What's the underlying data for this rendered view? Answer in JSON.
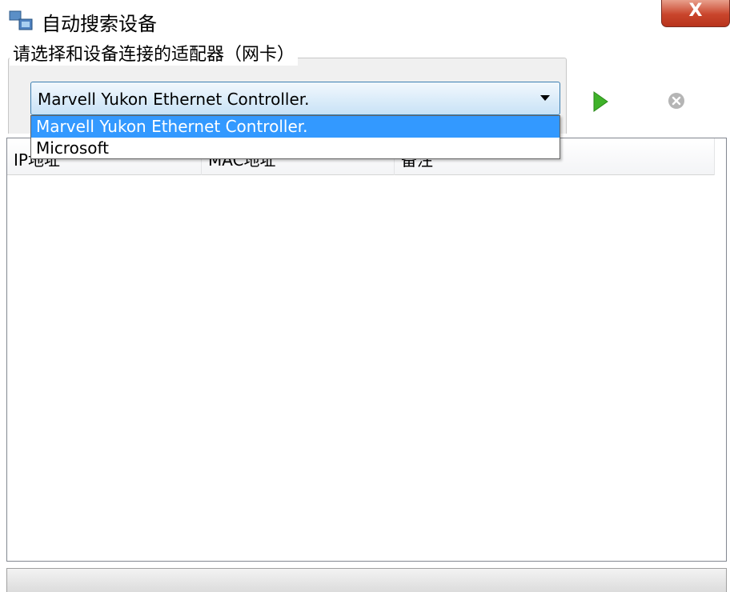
{
  "window": {
    "title": "自动搜索设备",
    "close_label": "X"
  },
  "adapter_group": {
    "title": "请选择和设备连接的适配器（网卡）"
  },
  "adapter_combo": {
    "value": "Marvell Yukon Ethernet Controller.",
    "options": [
      "Marvell Yukon Ethernet Controller.",
      "Microsoft"
    ]
  },
  "toolbar": {
    "start_icon": "play-icon",
    "stop_icon": "stop-icon"
  },
  "device_list": {
    "columns": [
      "IP地址",
      "MAC地址",
      "备注"
    ]
  },
  "colors": {
    "accent": "#3399ff",
    "play": "#3fb22a",
    "close": "#c9452c"
  }
}
